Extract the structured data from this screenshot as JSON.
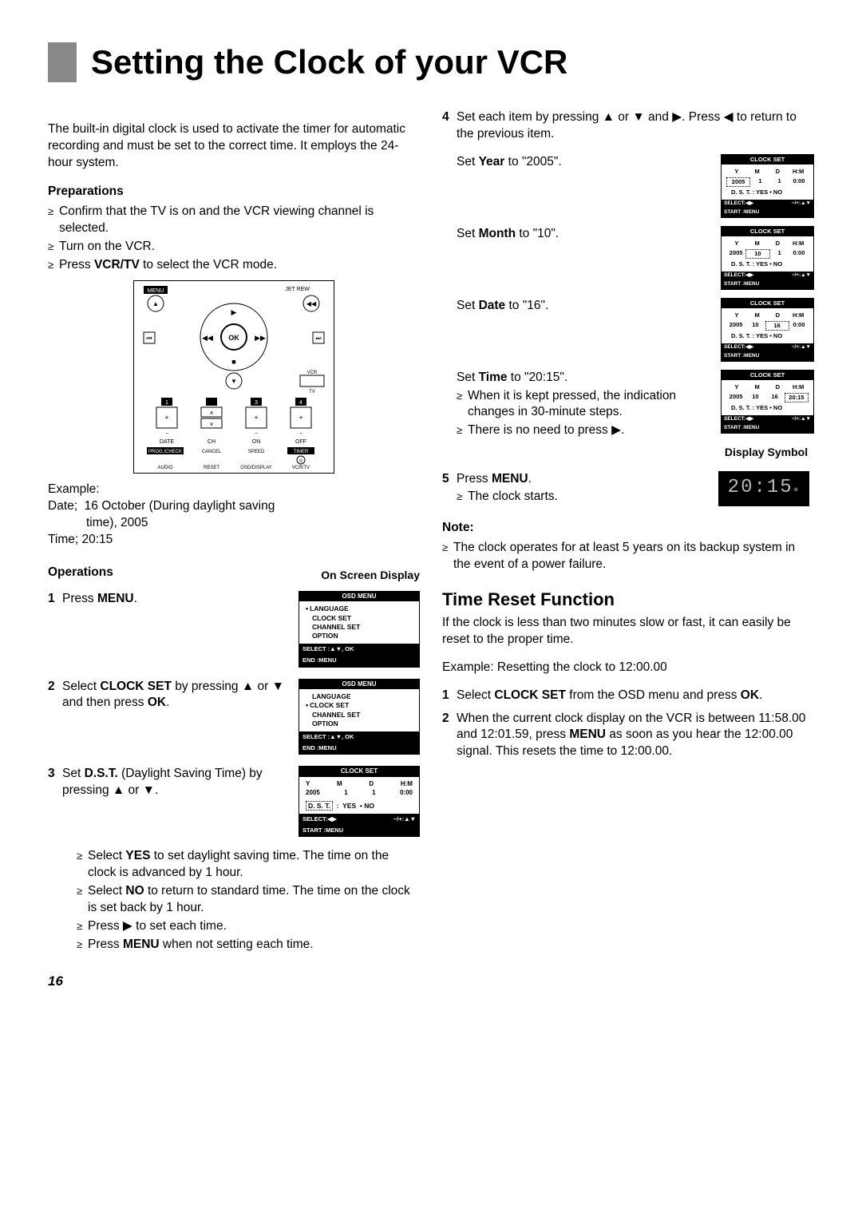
{
  "page_title": "Setting the Clock of your VCR",
  "intro": "The built-in digital clock is used to activate the timer for automatic recording and must be set to the correct time. It employs the 24-hour system.",
  "preparations_head": "Preparations",
  "preparations": [
    "Confirm that the TV is on and the VCR viewing channel is selected.",
    "Turn on the VCR.",
    "Press VCR/TV to select the VCR mode."
  ],
  "example_label": "Example:",
  "example_date": "Date;  16 October (During daylight saving time), 2005",
  "example_time": "Time;  20:15",
  "operations_head": "Operations",
  "osd_head": "On Screen Display",
  "step1": "Press MENU.",
  "step2": "Select CLOCK SET by pressing ▲ or ▼ and then press OK.",
  "step3": "Set D.S.T. (Daylight Saving Time) by pressing ▲ or ▼.",
  "step3_bullets": [
    "Select YES to set daylight saving time. The time on the clock is advanced by 1 hour.",
    "Select NO to return to standard time. The time on the clock is set back by 1 hour.",
    "Press ▶ to set each time.",
    "Press MENU when not setting each time."
  ],
  "step4": "Set each item by pressing ▲ or ▼ and ▶. Press ◀ to return to the previous item.",
  "step4_year": "Set Year to \"2005\".",
  "step4_month": "Set Month to \"10\".",
  "step4_date": "Set Date to \"16\".",
  "step4_time": "Set Time to \"20:15\".",
  "step4_time_bullets": [
    "When it is kept pressed, the indication changes in 30-minute steps.",
    "There is no need to press ▶."
  ],
  "step5": "Press MENU.",
  "step5_bullet": "The clock starts.",
  "display_symbol_label": "Display Symbol",
  "display_symbol_value": "20:15",
  "note_head": "Note:",
  "note_bullet": "The clock operates for at least 5 years on its backup system in the event of a power failure.",
  "time_reset_head": "Time Reset Function",
  "time_reset_intro": "If the clock is less than two minutes slow or fast, it can easily be reset to the proper time.",
  "time_reset_example": "Example:  Resetting the clock to 12:00.00",
  "time_reset_step1": "Select CLOCK SET from the OSD menu and press OK.",
  "time_reset_step2": "When the current clock display on the VCR is between 11:58.00 and 12:01.59, press MENU as soon as you hear the 12:00.00 signal. This resets the time to 12:00.00.",
  "page_number": "16",
  "osd_menu_title": "OSD MENU",
  "osd_items": [
    "LANGUAGE",
    "CLOCK SET",
    "CHANNEL SET",
    "OPTION"
  ],
  "osd_foot_left": "SELECT :▲▼, OK",
  "osd_foot_end": "END     :MENU",
  "clockset_title": "CLOCK SET",
  "clockset_cols": [
    "Y",
    "M",
    "D",
    "H:M"
  ],
  "clock_defaults": [
    "2005",
    "1",
    "1",
    "0:00"
  ],
  "clock_year": [
    "2005",
    "1",
    "1",
    "0:00"
  ],
  "clock_month": [
    "2005",
    "10",
    "1",
    "0:00"
  ],
  "clock_date": [
    "2005",
    "10",
    "16",
    "0:00"
  ],
  "clock_time": [
    "2005",
    "10",
    "16",
    "20:15"
  ],
  "dst_line": "D. S. T.    :  YES   • NO",
  "clock_foot_left": "SELECT:◀▶",
  "clock_foot_right": "−/+:▲▼",
  "clock_foot_start": "START  :MENU",
  "remote_labels": {
    "menu": "MENU",
    "jetrew": "JET REW",
    "ok": "OK",
    "vcrtv": "VCR\nTV",
    "date": "DATE",
    "ch": "CH",
    "on": "ON",
    "off": "OFF",
    "progcheck": "PROG./CHECK",
    "cancel": "CANCEL",
    "speed": "SPEED",
    "timer": "TIMER",
    "audio": "AUDIO",
    "reset": "RESET",
    "osddisplay": "OSD/DISPLAY",
    "vcrtv2": "VCR/TV"
  }
}
